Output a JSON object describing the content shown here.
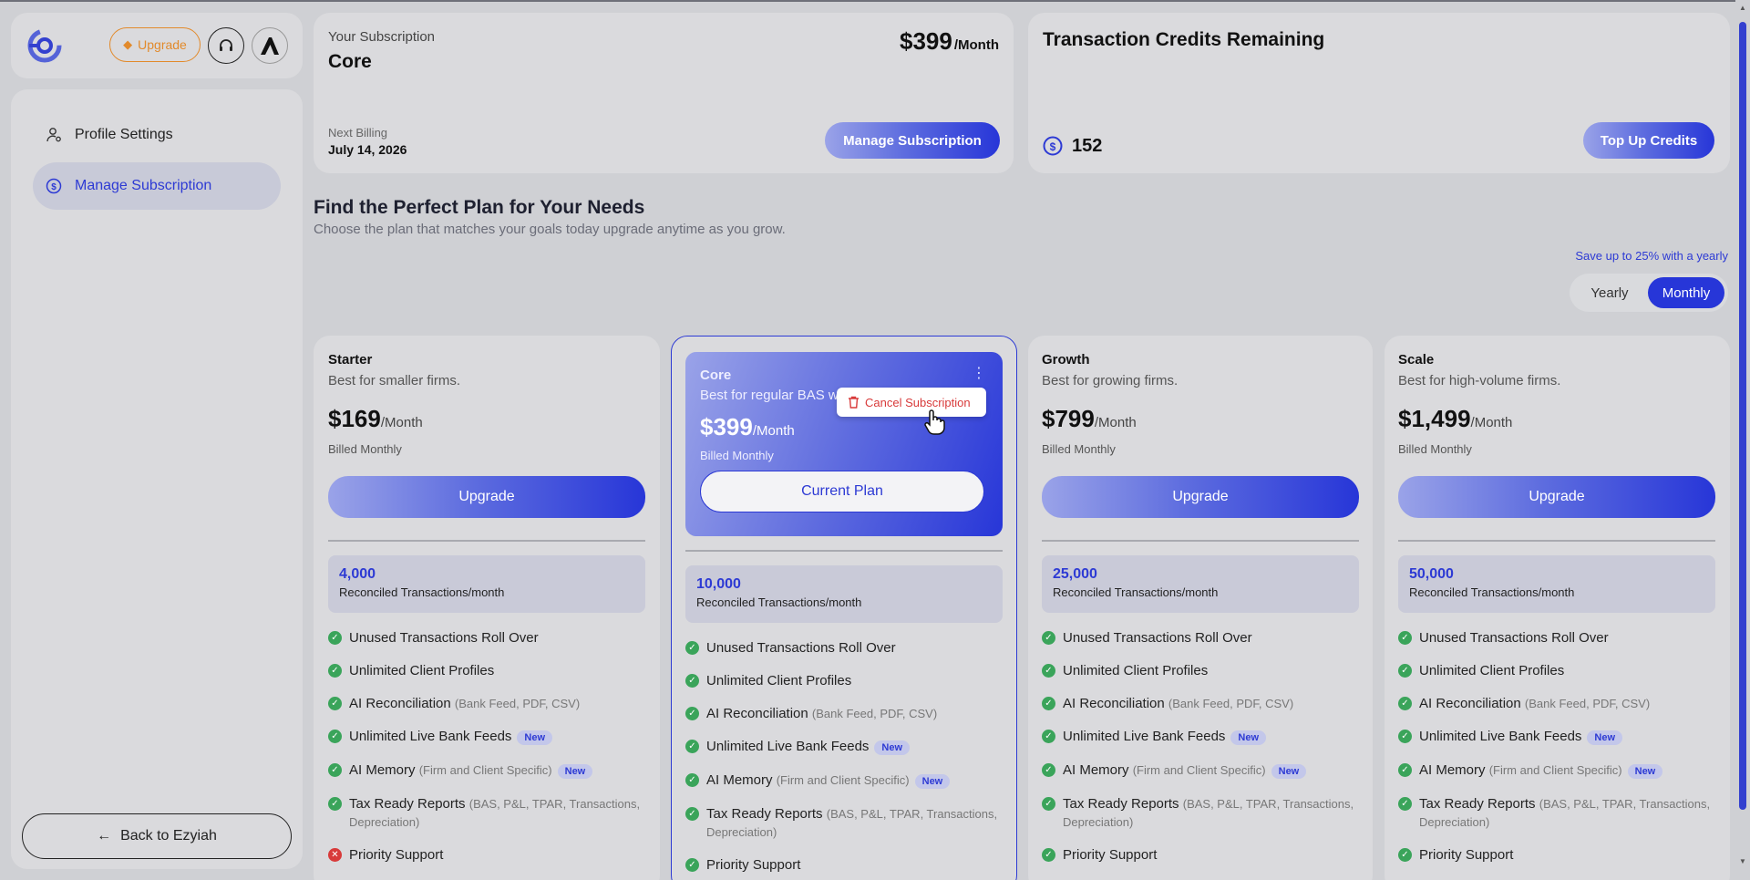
{
  "header": {
    "upgrade_label": "Upgrade"
  },
  "sidebar": {
    "items": [
      {
        "label": "Profile Settings",
        "icon": "user-gear-icon"
      },
      {
        "label": "Manage Subscription",
        "icon": "subscription-icon"
      }
    ],
    "back_label": "Back to Ezyiah"
  },
  "subscription": {
    "label": "Your Subscription",
    "plan": "Core",
    "price": "$399",
    "period": "/Month",
    "next_billing_label": "Next Billing",
    "next_billing_date": "July 14, 2026",
    "manage_button": "Manage Subscription"
  },
  "credits": {
    "title": "Transaction Credits Remaining",
    "count": "152",
    "topup_button": "Top Up Credits"
  },
  "plans_section": {
    "title": "Find the Perfect Plan for Your Needs",
    "subtitle": "Choose the plan that matches your goals today upgrade anytime as you grow.",
    "save_note": "Save up to 25% with a yearly",
    "toggle": {
      "yearly": "Yearly",
      "monthly": "Monthly",
      "selected": "Monthly"
    }
  },
  "cancel_popup": {
    "label": "Cancel Subscription"
  },
  "features": {
    "rollover": "Unused Transactions Roll Over",
    "profiles": "Unlimited Client Profiles",
    "ai_recon": "AI Reconciliation",
    "ai_recon_sub": "(Bank Feed, PDF, CSV)",
    "bank_feeds": "Unlimited Live Bank Feeds",
    "ai_memory": "AI Memory",
    "ai_memory_sub": "(Firm and Client Specific)",
    "tax_reports": "Tax Ready Reports",
    "tax_reports_sub": "(BAS, P&L, TPAR, Transactions, Depreciation)",
    "priority": "Priority Support",
    "new_badge": "New",
    "tx_label": "Reconciled Transactions/month"
  },
  "plans": [
    {
      "name": "Starter",
      "desc": "Best for smaller firms.",
      "price": "$169",
      "period": "/Month",
      "billed": "Billed Monthly",
      "button": "Upgrade",
      "transactions": "4,000",
      "priority_included": false
    },
    {
      "name": "Core",
      "desc": "Best for regular BAS w",
      "price": "$399",
      "period": "/Month",
      "billed": "Billed Monthly",
      "button": "Current Plan",
      "transactions": "10,000",
      "priority_included": true
    },
    {
      "name": "Growth",
      "desc": "Best for growing firms.",
      "price": "$799",
      "period": "/Month",
      "billed": "Billed Monthly",
      "button": "Upgrade",
      "transactions": "25,000",
      "priority_included": true
    },
    {
      "name": "Scale",
      "desc": "Best for high-volume firms.",
      "price": "$1,499",
      "period": "/Month",
      "billed": "Billed Monthly",
      "button": "Upgrade",
      "transactions": "50,000",
      "priority_included": true
    }
  ],
  "colors": {
    "accent": "#2d3ad4",
    "upgrade_orange": "#e28a2b",
    "check_green": "#3aa45a",
    "cross_red": "#d83a3a"
  }
}
